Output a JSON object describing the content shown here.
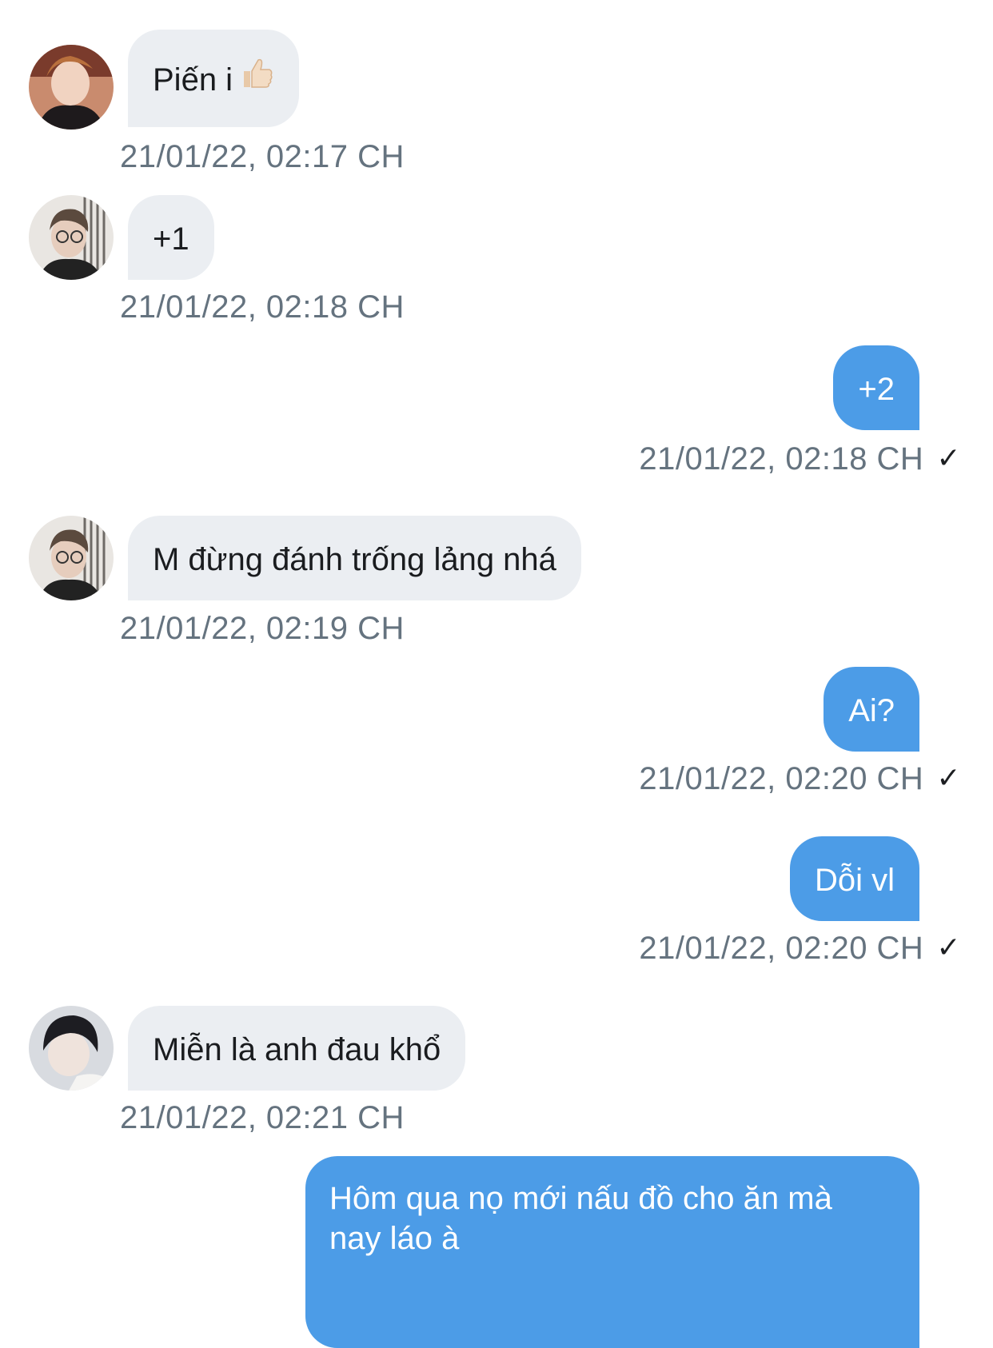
{
  "messages": [
    {
      "direction": "in",
      "avatar": "avatar-user-a",
      "text": "Piến i",
      "emoji": "thumbs-up-icon",
      "time": "21/01/22, 02:17 CH"
    },
    {
      "direction": "in",
      "avatar": "avatar-user-b",
      "text": "+1",
      "time": "21/01/22, 02:18 CH"
    },
    {
      "direction": "out",
      "text": "+2",
      "time": "21/01/22, 02:18 CH",
      "status": "✓"
    },
    {
      "direction": "in",
      "avatar": "avatar-user-b",
      "text": "M đừng đánh trống lảng nhá",
      "time": "21/01/22, 02:19 CH"
    },
    {
      "direction": "out",
      "text": "Ai?",
      "time": "21/01/22, 02:20 CH",
      "status": "✓"
    },
    {
      "direction": "out",
      "text": "Dỗi vl",
      "time": "21/01/22, 02:20 CH",
      "status": "✓"
    },
    {
      "direction": "in",
      "avatar": "avatar-user-c",
      "text": "Miễn là anh đau khổ",
      "time": "21/01/22, 02:21 CH"
    },
    {
      "direction": "out",
      "text_lines": [
        "Hôm qua nọ mới nấu đồ cho ăn mà",
        "nay láo à"
      ]
    }
  ],
  "colors": {
    "incoming_bubble": "#ebeef2",
    "outgoing_bubble": "#4c9ce7",
    "timestamp": "#65737f"
  }
}
